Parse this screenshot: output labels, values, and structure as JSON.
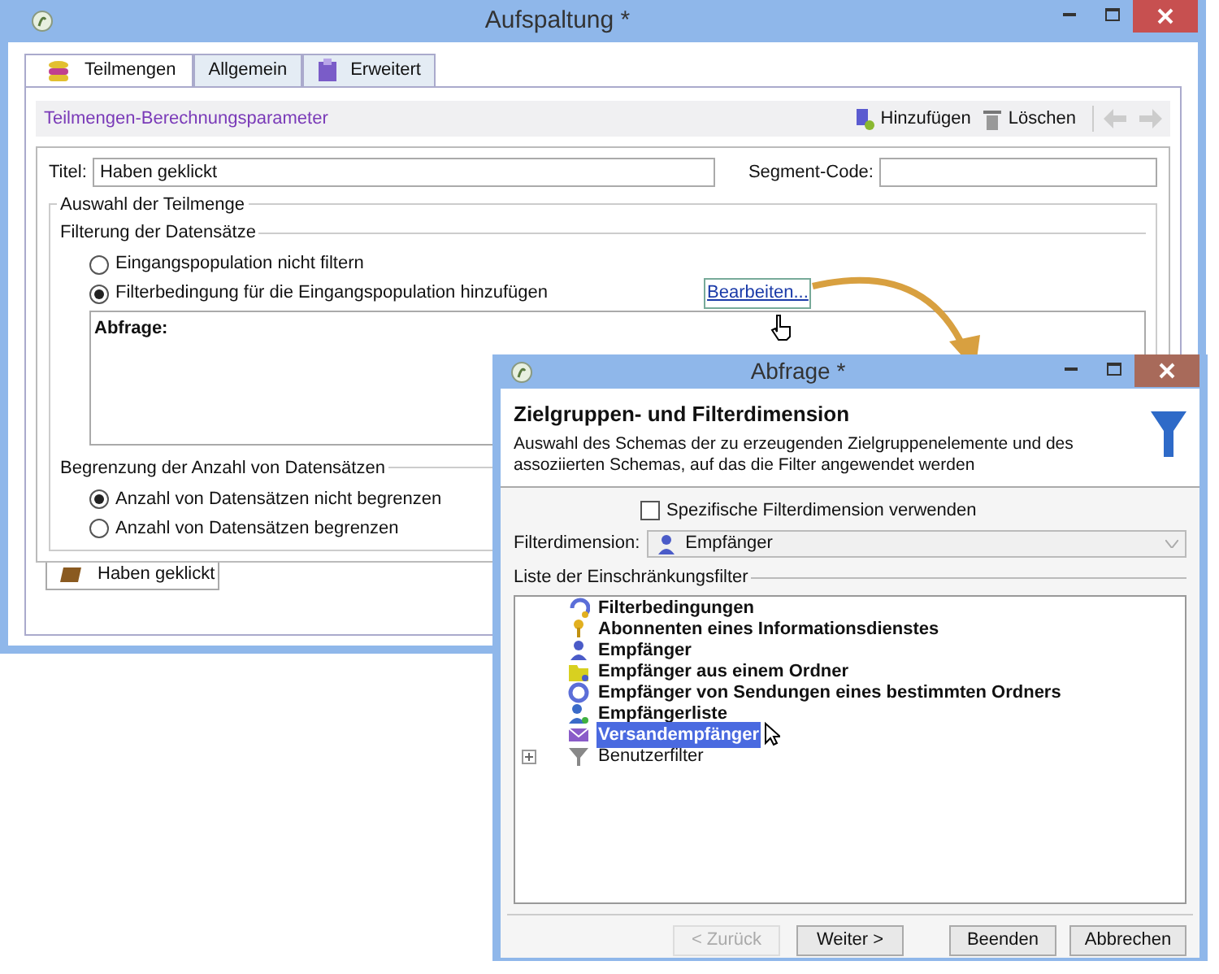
{
  "main_window": {
    "title": "Aufspaltung *",
    "tabs": [
      {
        "label": "Teilmengen",
        "selected": true,
        "kind": "subsets"
      },
      {
        "label": "Allgemein",
        "selected": false,
        "kind": "general"
      },
      {
        "label": "Erweitert",
        "selected": false,
        "kind": "advanced"
      }
    ],
    "toolbar": {
      "title": "Teilmengen-Berechnungsparameter",
      "buttons": [
        {
          "label": "Hinzufügen",
          "kind": "add"
        },
        {
          "label": "Löschen",
          "kind": "delete"
        }
      ]
    },
    "title_field": {
      "label": "Titel:",
      "value": "Haben geklickt"
    },
    "segment_field": {
      "label": "Segment-Code:"
    },
    "group_title": "Auswahl der Teilmenge",
    "filtering": {
      "title": "Filterung der Datensätze",
      "options": [
        {
          "label": "Eingangspopulation nicht filtern",
          "selected": false
        },
        {
          "label": "Filterbedingung für die Eingangspopulation hinzufügen",
          "selected": true
        }
      ],
      "edit_link": "Bearbeiten...",
      "query_label": "Abfrage:"
    },
    "limit": {
      "title": "Begrenzung der Anzahl von Datensätzen",
      "options": [
        {
          "label": "Anzahl von Datensätzen nicht begrenzen",
          "selected": true
        },
        {
          "label": "Anzahl von Datensätzen begrenzen",
          "selected": false
        }
      ]
    },
    "subset_tab": "Haben geklickt"
  },
  "dialog": {
    "title": "Abfrage *",
    "heading": "Zielgruppen- und Filterdimension",
    "description": "Auswahl des Schemas der zu erzeugenden Zielgruppenelemente und des assoziierten Schemas, auf das die Filter angewendet werden",
    "specific_dimension": {
      "label": "Spezifische Filterdimension verwenden",
      "checked": false
    },
    "filter_dimension": {
      "label": "Filterdimension:",
      "value": "Empfänger"
    },
    "list_title": "Liste der Einschränkungsfilter",
    "tree": [
      {
        "label": "Filterbedingungen",
        "selected": false,
        "kind": "conditions"
      },
      {
        "label": "Abonnenten eines Informationsdienstes",
        "selected": false,
        "kind": "subscribers"
      },
      {
        "label": "Empfänger",
        "selected": false,
        "kind": "recipient"
      },
      {
        "label": "Empfänger aus einem Ordner",
        "selected": false,
        "kind": "folder"
      },
      {
        "label": "Empfänger von Sendungen eines bestimmten Ordners",
        "selected": false,
        "kind": "deliveries"
      },
      {
        "label": "Empfängerliste",
        "selected": false,
        "kind": "list"
      },
      {
        "label": "Versandempfänger",
        "selected": true,
        "kind": "mail"
      },
      {
        "label": "Benutzerfilter",
        "selected": false,
        "kind": "user-filter",
        "expanded": false
      }
    ],
    "buttons": [
      {
        "label": "< Zurück",
        "disabled": true
      },
      {
        "label": "Weiter >",
        "disabled": false
      },
      {
        "label": "Beenden",
        "disabled": false
      },
      {
        "label": "Abbrechen",
        "disabled": false
      }
    ]
  }
}
